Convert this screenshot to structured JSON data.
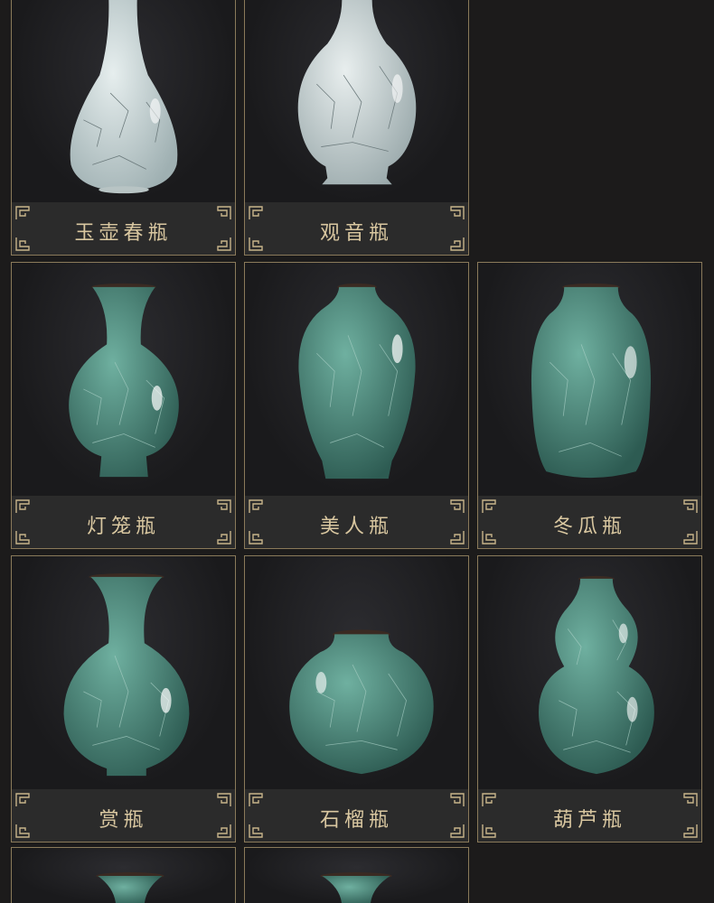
{
  "products": [
    {
      "name": "玉壶春瓶",
      "glaze": "white-crackle"
    },
    {
      "name": "观音瓶",
      "glaze": "white-crackle"
    },
    {
      "name": "灯笼瓶",
      "glaze": "green-crackle"
    },
    {
      "name": "美人瓶",
      "glaze": "green-crackle"
    },
    {
      "name": "冬瓜瓶",
      "glaze": "green-crackle"
    },
    {
      "name": "赏瓶",
      "glaze": "green-crackle"
    },
    {
      "name": "石榴瓶",
      "glaze": "green-crackle"
    },
    {
      "name": "葫芦瓶",
      "glaze": "green-crackle"
    },
    {
      "name": "",
      "glaze": "green-crackle"
    },
    {
      "name": "",
      "glaze": "green-crackle"
    }
  ],
  "colors": {
    "background": "#1c1b1b",
    "border": "#8a7a5a",
    "label_text": "#d9c7a0",
    "label_bg": "#2b2b2b",
    "white_glaze": "#c9d3d3",
    "green_glaze": "#4f8a7c"
  },
  "icons": {
    "corner": "fret-corner-icon",
    "vase": "vase-icon"
  }
}
